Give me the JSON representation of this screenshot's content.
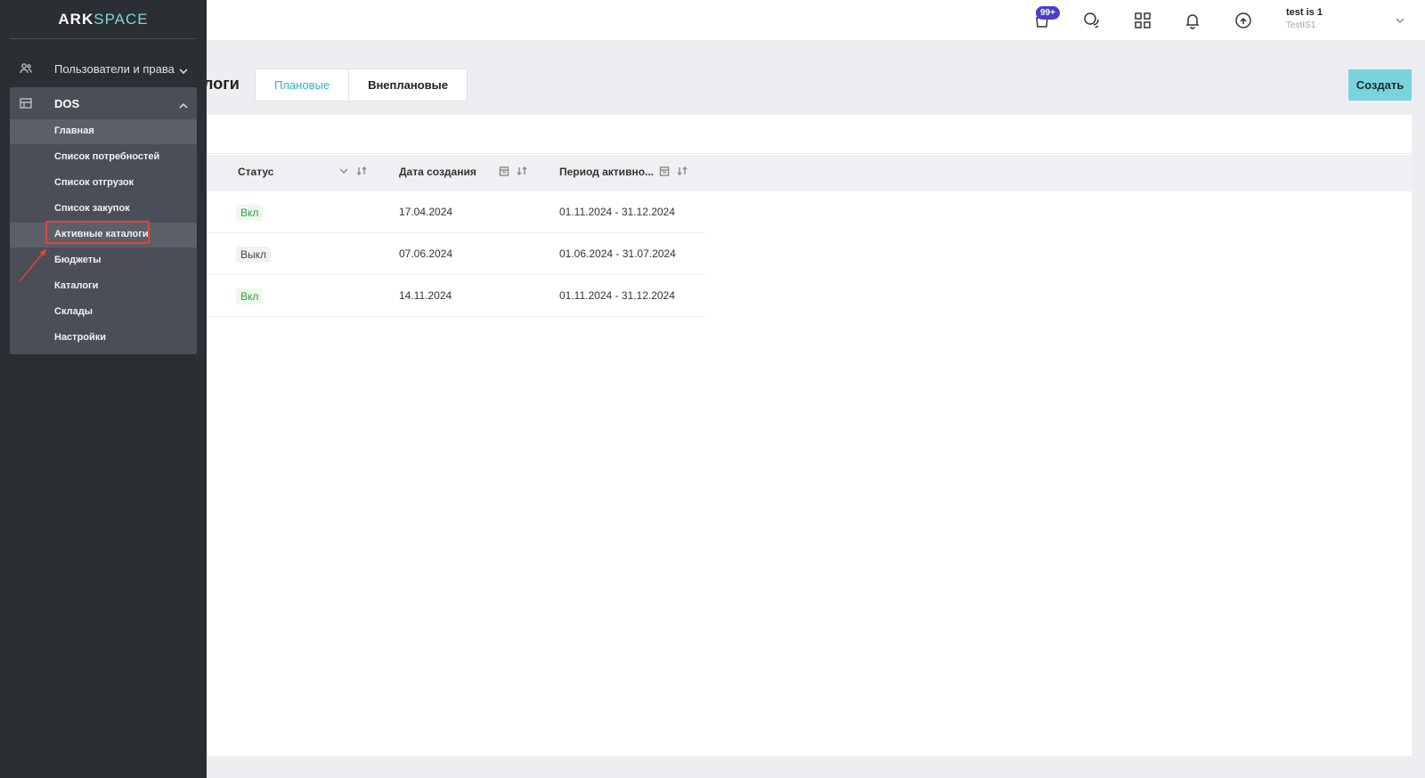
{
  "app": {
    "logo_main": "ARK",
    "logo_accent": "SPACE"
  },
  "topbar": {
    "cart_badge": "99+",
    "icons": [
      "cart-icon",
      "chat-icon",
      "apps-grid-icon",
      "bell-icon",
      "sync-icon"
    ],
    "user_name": "test is 1",
    "user_company": "TestIS1"
  },
  "sidebar": {
    "users_label": "Пользователи и права",
    "dos_label": "DOS",
    "sub_items": [
      {
        "label": "Главная"
      },
      {
        "label": "Список потребностей"
      },
      {
        "label": "Список отгрузок"
      },
      {
        "label": "Список закупок"
      },
      {
        "label": "Активные каталоги"
      },
      {
        "label": "Бюджеты"
      },
      {
        "label": "Каталоги"
      },
      {
        "label": "Склады"
      },
      {
        "label": "Настройки"
      }
    ]
  },
  "page": {
    "title_fragment": "логи",
    "tabs": [
      {
        "label": "Плановые"
      },
      {
        "label": "Внеплановые"
      }
    ],
    "create_label": "Создать"
  },
  "table": {
    "columns": [
      {
        "label": "Статус"
      },
      {
        "label": "Дата создания"
      },
      {
        "label": "Период активно..."
      }
    ],
    "rows": [
      {
        "status": "Вкл",
        "created": "17.04.2024",
        "period": "01.11.2024 - 31.12.2024"
      },
      {
        "status": "Выкл",
        "created": "07.06.2024",
        "period": "01.06.2024 - 31.07.2024"
      },
      {
        "status": "Вкл",
        "created": "14.11.2024",
        "period": "01.11.2024 - 31.12.2024"
      }
    ]
  },
  "colors": {
    "accent": "#2bb6c6",
    "create_button": "#79d3dc",
    "sidebar_bg": "#2b2e33",
    "status_on": "#2fa13a",
    "annotation": "#e0443c"
  }
}
